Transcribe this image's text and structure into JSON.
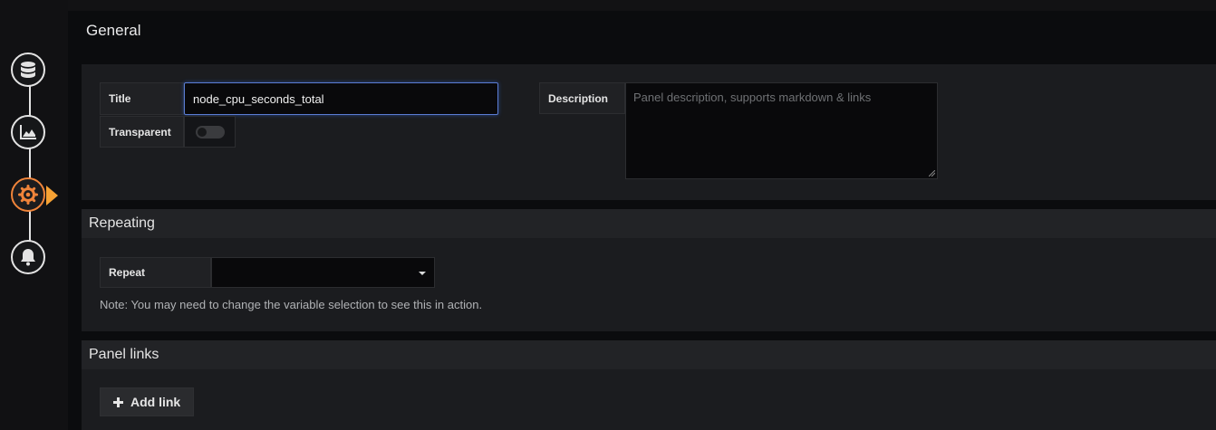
{
  "sidebar": {
    "items": [
      {
        "name": "queries",
        "icon": "database-icon"
      },
      {
        "name": "visualization",
        "icon": "chart-area-icon"
      },
      {
        "name": "general",
        "icon": "settings-icon",
        "active": true
      },
      {
        "name": "alert",
        "icon": "bell-icon"
      }
    ],
    "active_color": "#f0843a"
  },
  "general": {
    "heading": "General",
    "title_label": "Title",
    "title_value": "node_cpu_seconds_total",
    "transparent_label": "Transparent",
    "transparent_on": false,
    "description_label": "Description",
    "description_placeholder": "Panel description, supports markdown & links"
  },
  "repeating": {
    "heading": "Repeating",
    "repeat_label": "Repeat",
    "repeat_value": "",
    "note": "Note: You may need to change the variable selection to see this in action."
  },
  "panel_links": {
    "heading": "Panel links",
    "add_link_label": "Add link"
  }
}
